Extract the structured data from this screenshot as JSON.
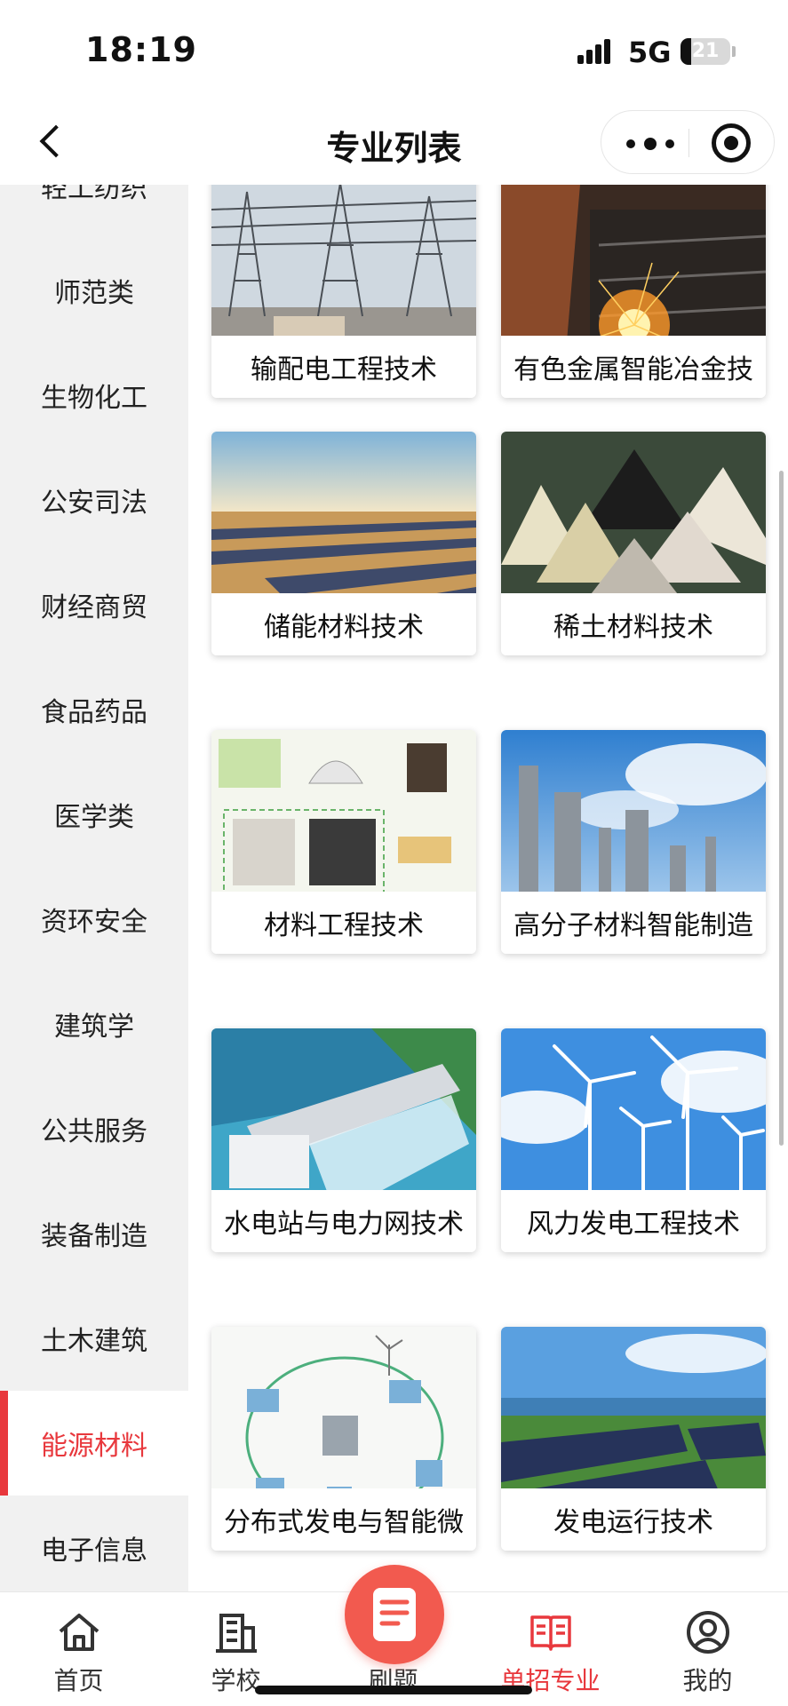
{
  "status_bar": {
    "time": "18:19",
    "network": "5G",
    "battery": "21",
    "battery_level": 0.21
  },
  "nav": {
    "title": "专业列表"
  },
  "sidebar": {
    "items": [
      {
        "label": "轻工纺织",
        "active": false
      },
      {
        "label": "师范类",
        "active": false
      },
      {
        "label": "生物化工",
        "active": false
      },
      {
        "label": "公安司法",
        "active": false
      },
      {
        "label": "财经商贸",
        "active": false
      },
      {
        "label": "食品药品",
        "active": false
      },
      {
        "label": "医学类",
        "active": false
      },
      {
        "label": "资环安全",
        "active": false
      },
      {
        "label": "建筑学",
        "active": false
      },
      {
        "label": "公共服务",
        "active": false
      },
      {
        "label": "装备制造",
        "active": false
      },
      {
        "label": "土木建筑",
        "active": false
      },
      {
        "label": "能源材料",
        "active": true
      },
      {
        "label": "电子信息",
        "active": false
      }
    ]
  },
  "majors": [
    {
      "label": "输配电工程技术",
      "image": "power-substation-image"
    },
    {
      "label": "有色金属智能冶金技",
      "image": "metal-sparks-image"
    },
    {
      "label": "储能材料技术",
      "image": "solar-farm-desert-image"
    },
    {
      "label": "稀土材料技术",
      "image": "rare-earth-powders-image"
    },
    {
      "label": "材料工程技术",
      "image": "materials-diagram-image"
    },
    {
      "label": "高分子材料智能制造",
      "image": "petrochemical-plant-image"
    },
    {
      "label": "水电站与电力网技术",
      "image": "hydro-dam-image"
    },
    {
      "label": "风力发电工程技术",
      "image": "wind-turbines-image"
    },
    {
      "label": "分布式发电与智能微",
      "image": "microgrid-diagram-image"
    },
    {
      "label": "发电运行技术",
      "image": "solar-field-coast-image"
    }
  ],
  "tabs": [
    {
      "label": "首页",
      "icon": "home-icon",
      "active": false
    },
    {
      "label": "学校",
      "icon": "building-icon",
      "active": false
    },
    {
      "label": "刷题",
      "icon": "document-icon",
      "active": false
    },
    {
      "label": "单招专业",
      "icon": "book-icon",
      "active": true
    },
    {
      "label": "我的",
      "icon": "user-icon",
      "active": false
    }
  ],
  "colors": {
    "accent": "#e8383d",
    "sidebar_bg": "#f1f1f1",
    "center_button": "#f25a4f"
  }
}
